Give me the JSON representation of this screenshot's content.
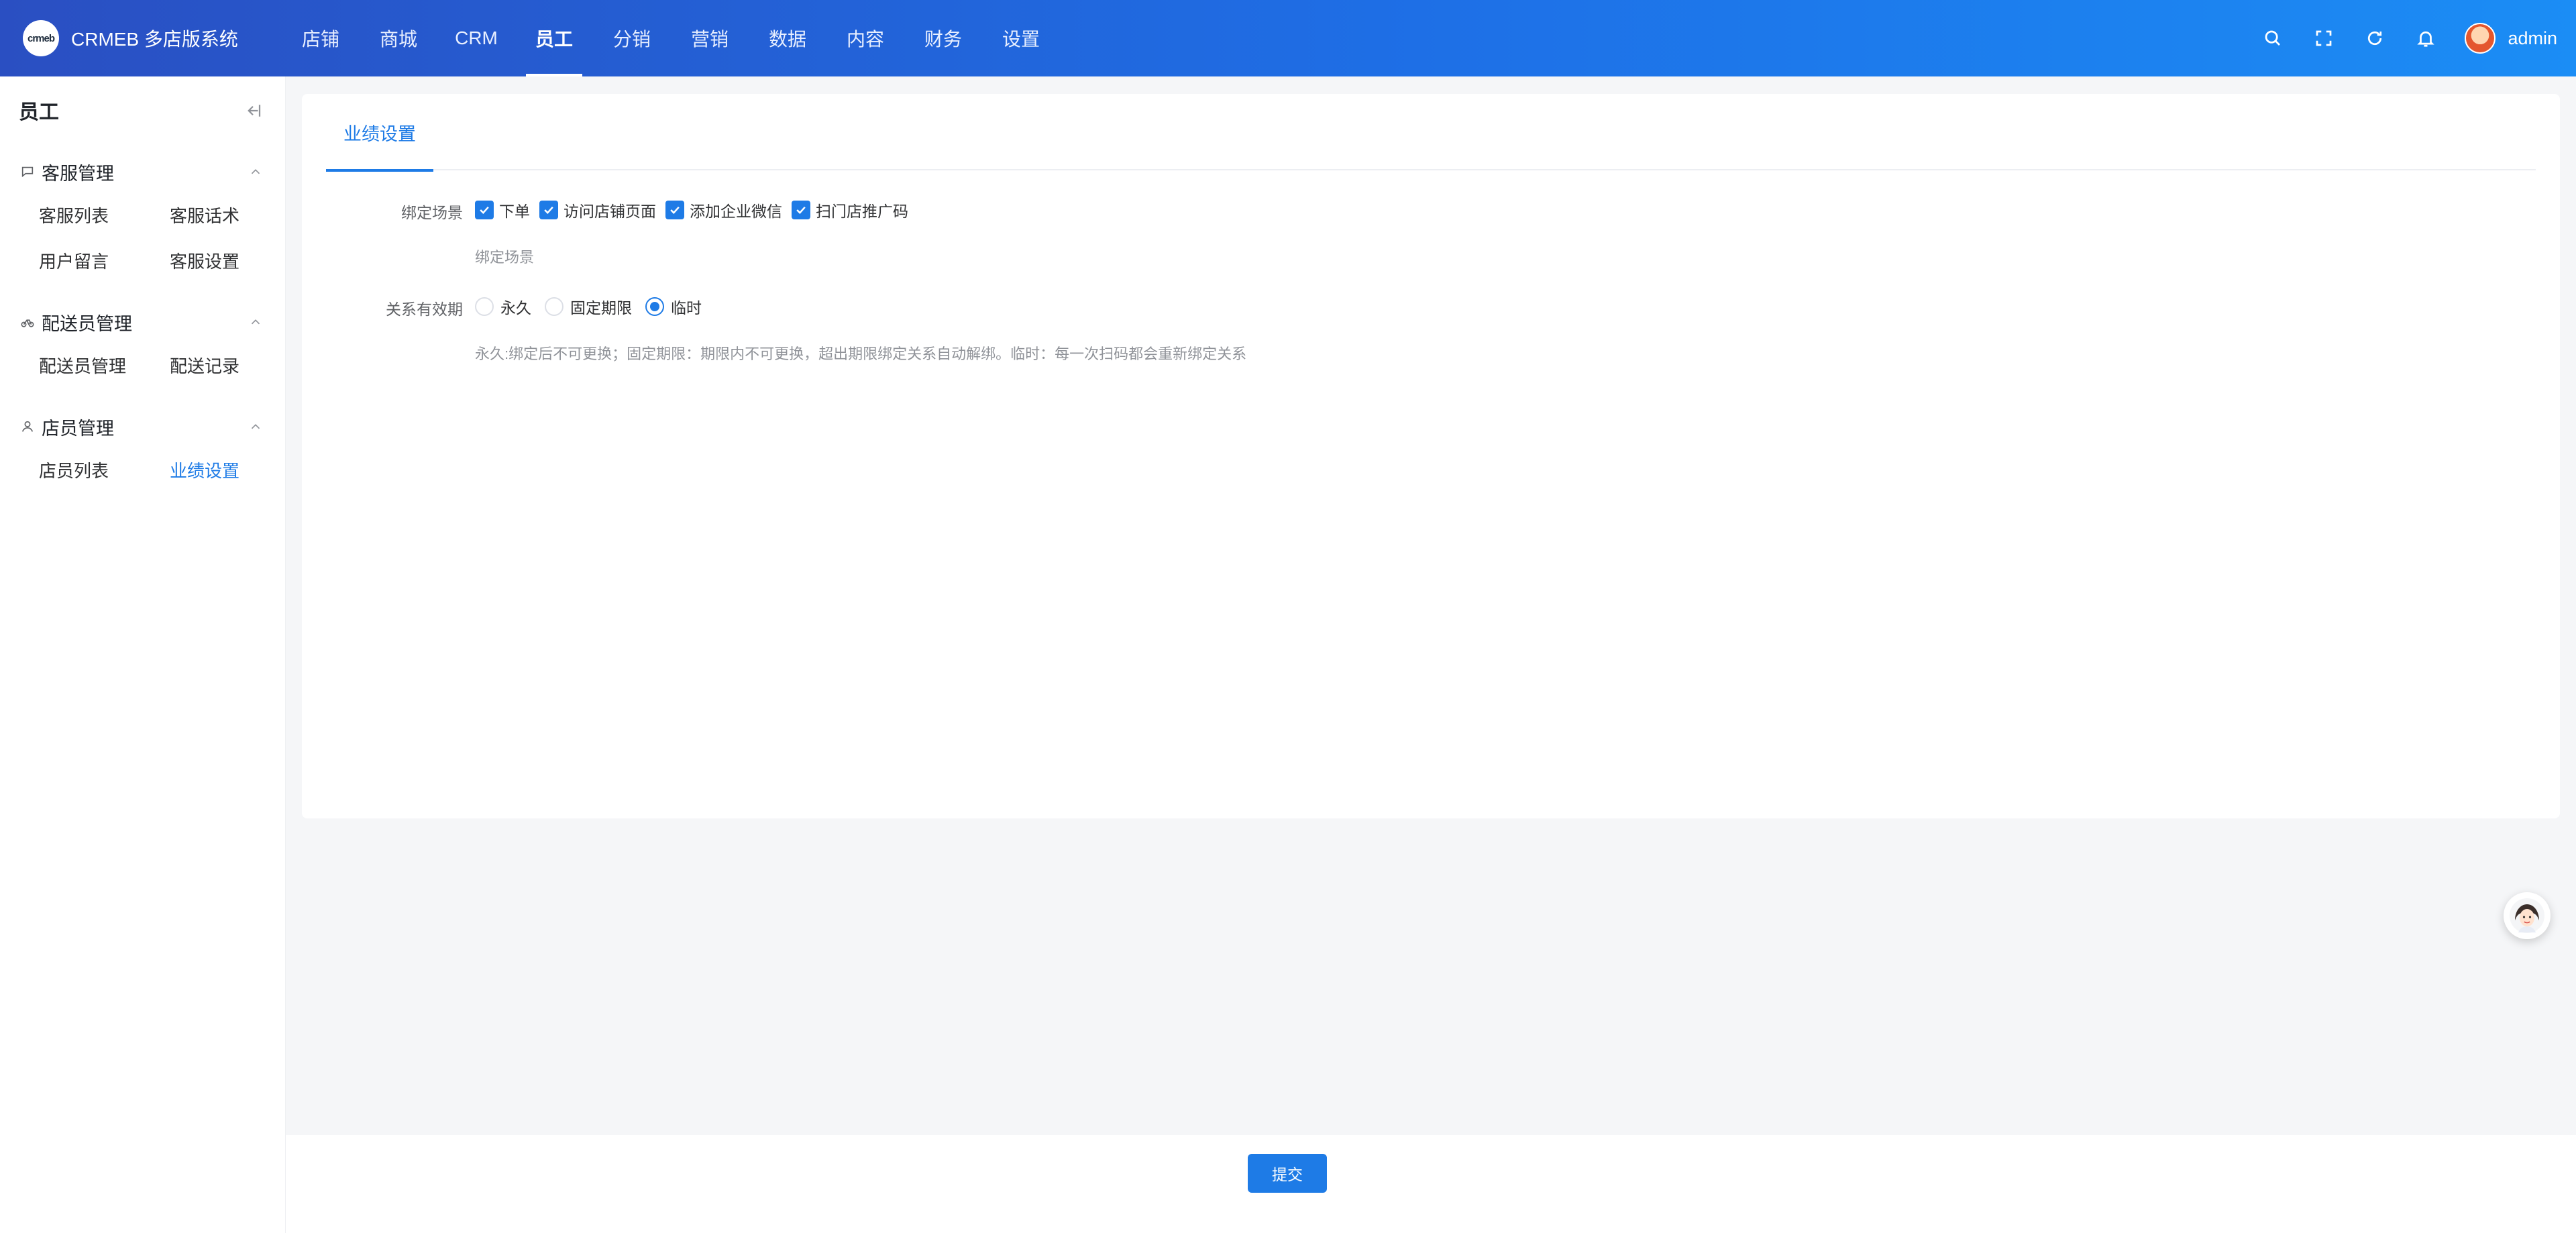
{
  "app": {
    "logo_text": "crmeb",
    "title": "CRMEB 多店版系统"
  },
  "nav": {
    "items": [
      {
        "label": "店铺"
      },
      {
        "label": "商城"
      },
      {
        "label": "CRM"
      },
      {
        "label": "员工",
        "active": true
      },
      {
        "label": "分销"
      },
      {
        "label": "营销"
      },
      {
        "label": "数据"
      },
      {
        "label": "内容"
      },
      {
        "label": "财务"
      },
      {
        "label": "设置"
      }
    ]
  },
  "header_icons": [
    "search-icon",
    "fullscreen-icon",
    "refresh-icon",
    "bell-icon"
  ],
  "user": {
    "name": "admin"
  },
  "sidebar": {
    "title": "员工",
    "groups": [
      {
        "title": "客服管理",
        "icon": "chat-icon",
        "items": [
          {
            "label": "客服列表"
          },
          {
            "label": "客服话术"
          },
          {
            "label": "用户留言"
          },
          {
            "label": "客服设置"
          }
        ]
      },
      {
        "title": "配送员管理",
        "icon": "bicycle-icon",
        "items": [
          {
            "label": "配送员管理"
          },
          {
            "label": "配送记录"
          }
        ]
      },
      {
        "title": "店员管理",
        "icon": "person-icon",
        "items": [
          {
            "label": "店员列表"
          },
          {
            "label": "业绩设置",
            "active": true
          }
        ]
      }
    ]
  },
  "tabs": [
    {
      "label": "业绩设置"
    }
  ],
  "form": {
    "bind_scene": {
      "label": "绑定场景",
      "options": [
        {
          "label": "下单",
          "checked": true
        },
        {
          "label": "访问店铺页面",
          "checked": true
        },
        {
          "label": "添加企业微信",
          "checked": true
        },
        {
          "label": "扫门店推广码",
          "checked": true
        }
      ],
      "hint": "绑定场景"
    },
    "relation_period": {
      "label": "关系有效期",
      "options": [
        {
          "label": "永久",
          "selected": false
        },
        {
          "label": "固定期限",
          "selected": false
        },
        {
          "label": "临时",
          "selected": true
        }
      ],
      "hint": "永久:绑定后不可更换；固定期限：期限内不可更换，超出期限绑定关系自动解绑。临时：每一次扫码都会重新绑定关系"
    }
  },
  "footer": {
    "submit_label": "提交"
  },
  "colors": {
    "accent": "#1e7be6",
    "header_start": "#2a4fc2",
    "header_end": "#1b8df5"
  }
}
